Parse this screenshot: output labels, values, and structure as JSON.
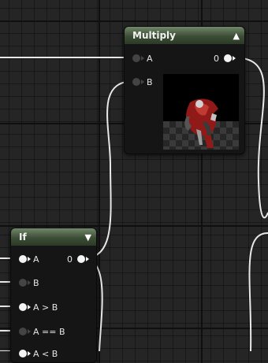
{
  "nodes": {
    "multiply": {
      "title": "Multiply",
      "inputs": [
        {
          "label": "A"
        },
        {
          "label": "B"
        }
      ],
      "output": {
        "label": "0"
      },
      "collapse_icon": "chevron-up-icon"
    },
    "if": {
      "title": "If",
      "inputs": [
        {
          "label": "A"
        },
        {
          "label": "B"
        },
        {
          "label": "A > B"
        },
        {
          "label": "A == B"
        },
        {
          "label": "A < B"
        }
      ],
      "output": {
        "label": "0"
      },
      "collapse_icon": "chevron-down-icon"
    }
  },
  "colors": {
    "header_green": "#4f6447",
    "pin_connected": "#f4f4f4",
    "pin_unconnected": "#444444",
    "wire": "#e8e8e8",
    "background": "#252525"
  }
}
